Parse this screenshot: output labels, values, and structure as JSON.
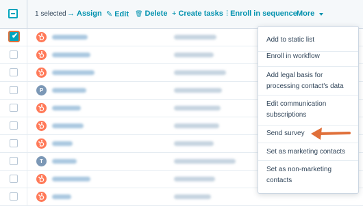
{
  "toolbar": {
    "selected_count": "1 selected",
    "actions": [
      {
        "label": "Assign",
        "icon": "→"
      },
      {
        "label": "Edit",
        "icon": "✎"
      },
      {
        "label": "Delete",
        "icon": "🗑"
      },
      {
        "label": "Create tasks",
        "icon": "+"
      },
      {
        "label": "Enroll in sequence",
        "icon": "⁞"
      }
    ],
    "more_label": "More"
  },
  "rows": [
    {
      "avatar": "hub",
      "initial": "",
      "checked": true
    },
    {
      "avatar": "hub",
      "initial": "",
      "checked": false
    },
    {
      "avatar": "hub",
      "initial": "",
      "checked": false
    },
    {
      "avatar": "initial",
      "initial": "P",
      "checked": false
    },
    {
      "avatar": "hub",
      "initial": "",
      "checked": false
    },
    {
      "avatar": "hub",
      "initial": "",
      "checked": false
    },
    {
      "avatar": "hub",
      "initial": "",
      "checked": false
    },
    {
      "avatar": "initial",
      "initial": "T",
      "checked": false
    },
    {
      "avatar": "hub",
      "initial": "",
      "checked": false
    },
    {
      "avatar": "hub",
      "initial": "",
      "checked": false
    }
  ],
  "more_menu": {
    "items": [
      {
        "label": "Add to static list"
      },
      {
        "label": "Enroll in workflow"
      },
      {
        "label": "Add legal basis for processing contact's data"
      },
      {
        "label": "Edit communication subscriptions"
      },
      {
        "label": "Send survey"
      },
      {
        "label": "Set as marketing contacts"
      },
      {
        "label": "Set as non-marketing contacts"
      }
    ]
  },
  "colors": {
    "accent": "#0091ae",
    "checkbox": "#00a4bd",
    "hubspot_orange": "#ff7a59",
    "annotation_arrow": "#e0703a"
  }
}
